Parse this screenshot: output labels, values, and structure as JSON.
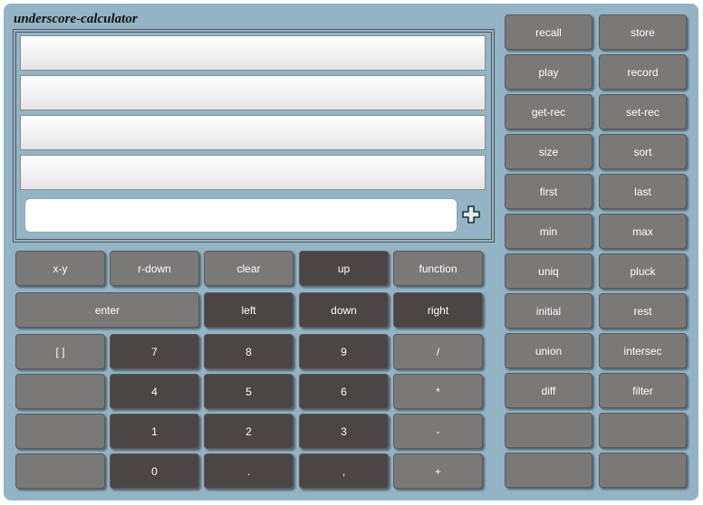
{
  "app": {
    "title": "underscore-calculator"
  },
  "display": {
    "stack_rows": [
      "",
      "",
      "",
      ""
    ],
    "entry_value": "",
    "add_icon": "plus-icon"
  },
  "colors": {
    "panel": "#92b4c5",
    "light_button": "#7b7878",
    "dark_button": "#4b4545"
  },
  "keypad": {
    "row1": [
      "x-y",
      "r-down",
      "clear",
      "up",
      "function"
    ],
    "row2": [
      "enter",
      "left",
      "down",
      "right"
    ],
    "row3": [
      "[ ]",
      "7",
      "8",
      "9",
      "/"
    ],
    "row4": [
      "",
      "4",
      "5",
      "6",
      "*"
    ],
    "row5": [
      "",
      "1",
      "2",
      "3",
      "-"
    ],
    "row6": [
      "",
      "0",
      ".",
      ",",
      "+"
    ]
  },
  "functions": {
    "rows": [
      [
        "recall",
        "store"
      ],
      [
        "play",
        "record"
      ],
      [
        "get-rec",
        "set-rec"
      ],
      [
        "size",
        "sort"
      ],
      [
        "first",
        "last"
      ],
      [
        "min",
        "max"
      ],
      [
        "uniq",
        "pluck"
      ],
      [
        "initial",
        "rest"
      ],
      [
        "union",
        "intersec"
      ],
      [
        "diff",
        "filter"
      ],
      [
        "",
        ""
      ],
      [
        "",
        ""
      ]
    ]
  }
}
